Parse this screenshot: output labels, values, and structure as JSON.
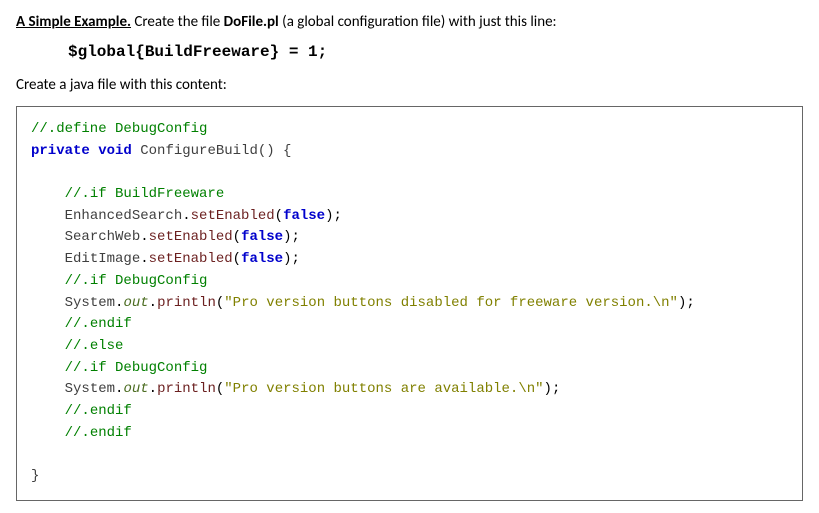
{
  "heading": {
    "lead": "A Simple Example.",
    "rest": "  Create the file ",
    "filename": "DoFile.pl",
    "tail": " (a global configuration file) with just this line:"
  },
  "config_code": "$global{BuildFreeware} = 1;",
  "second_intro": "Create a java file with this content:",
  "code": {
    "l01": "//.define DebugConfig",
    "l02a": "private",
    "l02b": "void",
    "l02c": "ConfigureBuild() {",
    "l03": "//.if BuildFreeware",
    "l04a": "EnhancedSearch",
    "l04b": "setEnabled",
    "l04c": "false",
    "l05a": "SearchWeb",
    "l05b": "setEnabled",
    "l05c": "false",
    "l06a": "EditImage",
    "l06b": "setEnabled",
    "l06c": "false",
    "l07": "//.if DebugConfig",
    "l08a": "System",
    "l08b": "out",
    "l08c": "println",
    "l08d": "\"Pro version buttons disabled for freeware version.\\n\"",
    "l09": "//.endif",
    "l10": "//.else",
    "l11": "//.if DebugConfig",
    "l12a": "System",
    "l12b": "out",
    "l12c": "println",
    "l12d": "\"Pro version buttons are available.\\n\"",
    "l13": "//.endif",
    "l14": "//.endif",
    "l15": "}"
  }
}
